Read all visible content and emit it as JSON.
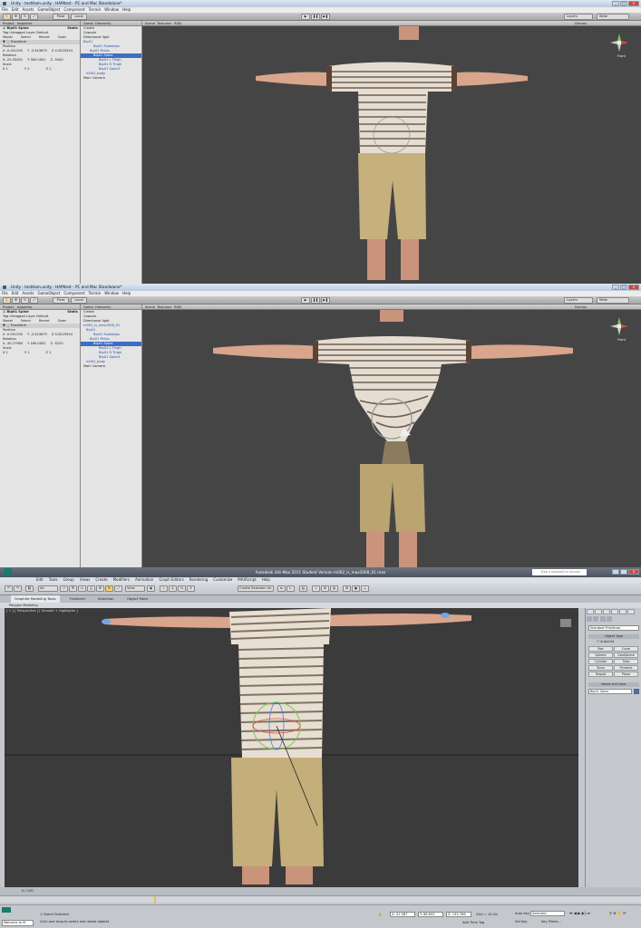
{
  "unity": {
    "title": "Unity - testHam.unity - HAMtest - PC and Mac Standalone*",
    "menu": [
      "File",
      "Edit",
      "Assets",
      "GameObject",
      "Component",
      "Terrain",
      "Window",
      "Help"
    ],
    "toolbar": {
      "pivot": "Pivot",
      "local": "Local",
      "layers": "Layers",
      "layout": "Wide"
    },
    "tabs": {
      "project": "Project",
      "inspector": "Inspector",
      "game": "Game",
      "hierarchy": "Hierarchy",
      "scene": "Scene"
    },
    "inspector": {
      "object_name": "Bip01 Spine",
      "static": "Static",
      "tag_label": "Tag",
      "tag_value": "Untagged",
      "layer_label": "Layer",
      "layer_value": "Default",
      "prefab_buttons": [
        "Model",
        "Select",
        "Revert",
        "Open"
      ],
      "component": "Transform",
      "position_label": "Position",
      "rotation_label": "Rotation",
      "scale_label": "Scale"
    },
    "shots": [
      {
        "position": [
          "X -0.001292",
          "Y -2.543679",
          "Z 4.0025554"
        ],
        "rotation": [
          "X -25.35491",
          "Y 360.0001",
          "Z -5040"
        ],
        "scale": [
          "X 1",
          "Y 1",
          "Z 1"
        ],
        "hierarchy": [
          "Create",
          "Capsule",
          "Directional light",
          "Bip01",
          "Bip01 Footsteps",
          "Bip01 Pelvis",
          "Bip01 Spine",
          "Bip01 L Thigh",
          "Bip01 R Thigh",
          "Bip01 Spine1",
          "m002_body",
          "Main Camera"
        ]
      },
      {
        "position": [
          "X -0.001292",
          "Y -2.543679",
          "Z 4.0025554"
        ],
        "rotation": [
          "X -30.27984",
          "Y 180.0001",
          "Z -5220"
        ],
        "scale": [
          "X 1",
          "Y 1",
          "Z 1"
        ],
        "hierarchy": [
          "Create",
          "Capsule",
          "Directional light",
          "m002_ls_max2008_01",
          "Bip01",
          "Bip01 Footsteps",
          "Bip01 Pelvis",
          "Bip01 Spine",
          "Bip01 L Thigh",
          "Bip01 R Thigh",
          "Bip01 Spine1",
          "m002_body",
          "Main Camera"
        ]
      }
    ],
    "scene_mode": "Textured",
    "scene_rgb": "RGB",
    "gizmos": "Gizmos",
    "view_label": "Front"
  },
  "max": {
    "title": "Autodesk 3ds Max 2011   Student Version   m002_ls_max2008_01.max",
    "search_placeholder": "Type a keyword or phrase",
    "menu": [
      "Edit",
      "Tools",
      "Group",
      "Views",
      "Create",
      "Modifiers",
      "Animation",
      "Graph Editors",
      "Rendering",
      "Customize",
      "MAXScript",
      "Help"
    ],
    "selection_filter": "All",
    "view_dropdown": "View",
    "named_selection": "Create Selection Se",
    "ribbon_tabs": [
      "Graphite Modeling Tools",
      "Freeform",
      "Selection",
      "Object Paint"
    ],
    "subribbon": "Polygon Modeling",
    "viewport_label": "[ + ] [ Perspective ] [ Smooth + Highlights ]",
    "cmd": {
      "dropdown": "Standard Primitives",
      "rollout_object_type": "Object Type",
      "autogrid": "AutoGrid",
      "buttons": [
        "Box",
        "Cone",
        "Sphere",
        "GeoSphere",
        "Cylinder",
        "Tube",
        "Torus",
        "Pyramid",
        "Teapot",
        "Plane"
      ],
      "rollout_name": "Name and Color",
      "name_value": "Bip01 Spine"
    },
    "timeline": "0 / 100",
    "status": {
      "selected": "1 Object Selected",
      "prompt": "Click and drag to select and rotate objects",
      "x": "41.387",
      "y": "86.652",
      "z": "133.766",
      "grid": "Grid = 10.0in",
      "autokey": "Auto Key",
      "selected_dd": "Selected",
      "setkey": "Set Key",
      "keyfilters": "Key Filters...",
      "addtime": "Add Time Tag",
      "welcome": "Welcome to M"
    }
  }
}
